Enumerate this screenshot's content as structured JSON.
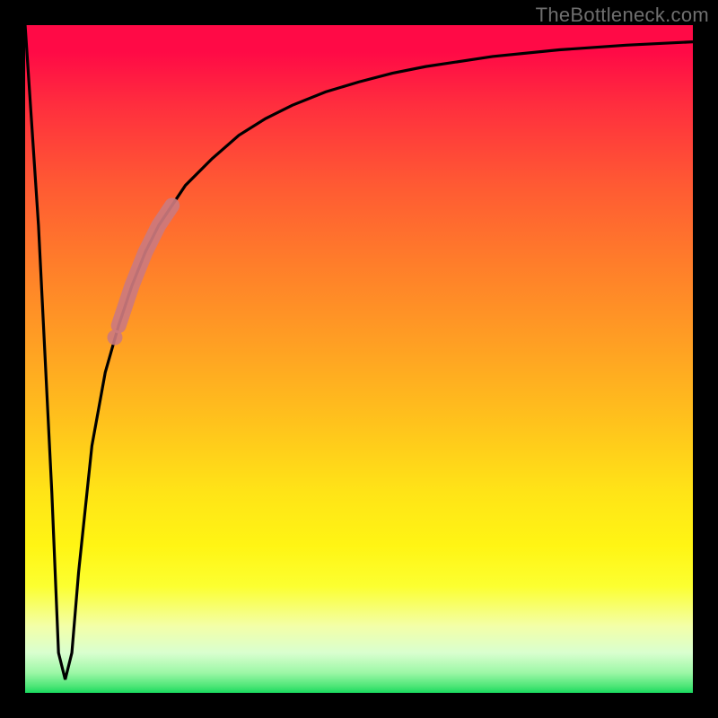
{
  "watermark": "TheBottleneck.com",
  "colors": {
    "frame": "#000000",
    "curve": "#000000",
    "highlight": "#cc7a7e"
  },
  "chart_data": {
    "type": "line",
    "title": "",
    "xlabel": "",
    "ylabel": "",
    "xlim": [
      0,
      100
    ],
    "ylim": [
      0,
      100
    ],
    "series": [
      {
        "name": "bottleneck-curve",
        "x": [
          0,
          2,
          4,
          5,
          6,
          7,
          8,
          10,
          12,
          14,
          16,
          18,
          20,
          24,
          28,
          32,
          36,
          40,
          45,
          50,
          55,
          60,
          70,
          80,
          90,
          100
        ],
        "y": [
          100,
          70,
          30,
          6,
          2,
          6,
          18,
          37,
          48,
          55,
          61,
          66,
          70,
          76,
          80,
          83.5,
          86,
          88,
          90,
          91.5,
          92.8,
          93.8,
          95.3,
          96.3,
          97,
          97.5
        ]
      }
    ],
    "highlight_segment": {
      "series": "bottleneck-curve",
      "x_start": 14,
      "x_end": 22,
      "note": "thick pink segment marking salient range"
    },
    "gradient_stops": [
      {
        "pos": 0.0,
        "color": "#ff0a46"
      },
      {
        "pos": 0.5,
        "color": "#ffc41c"
      },
      {
        "pos": 0.8,
        "color": "#fff514"
      },
      {
        "pos": 0.95,
        "color": "#9cf7a6"
      },
      {
        "pos": 1.0,
        "color": "#19d95f"
      }
    ]
  }
}
